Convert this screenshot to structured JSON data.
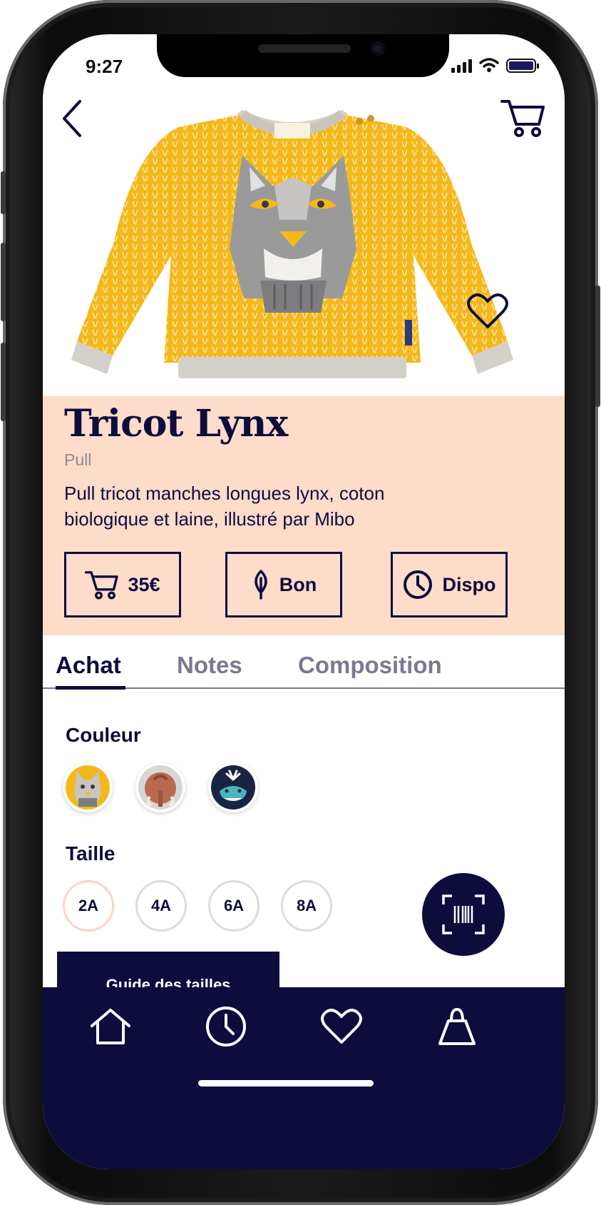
{
  "status_bar": {
    "time": "9:27"
  },
  "product": {
    "title": "Tricot Lynx",
    "category": "Pull",
    "description": "Pull tricot manches longues lynx, coton biologique et laine, illustré par Mibo"
  },
  "stats": {
    "price": "35€",
    "rating": "Bon",
    "availability": "Dispo"
  },
  "tabs": [
    {
      "label": "Achat",
      "active": true
    },
    {
      "label": "Notes",
      "active": false
    },
    {
      "label": "Composition",
      "active": false
    }
  ],
  "color_section": {
    "label": "Couleur",
    "options": [
      "lynx",
      "mammoth",
      "whale"
    ]
  },
  "size_section": {
    "label": "Taille",
    "options": [
      "2A",
      "4A",
      "6A",
      "8A"
    ],
    "selected": "2A"
  },
  "size_guide_label": "Guide des tailles",
  "bottom_nav": [
    "home-icon",
    "clock-icon",
    "heart-icon",
    "shopping-bag-icon"
  ],
  "colors": {
    "navy": "#0e0c3d",
    "peach": "#fddcca",
    "sweater_yellow": "#f4b81c",
    "muted_text": "#7b7891"
  }
}
